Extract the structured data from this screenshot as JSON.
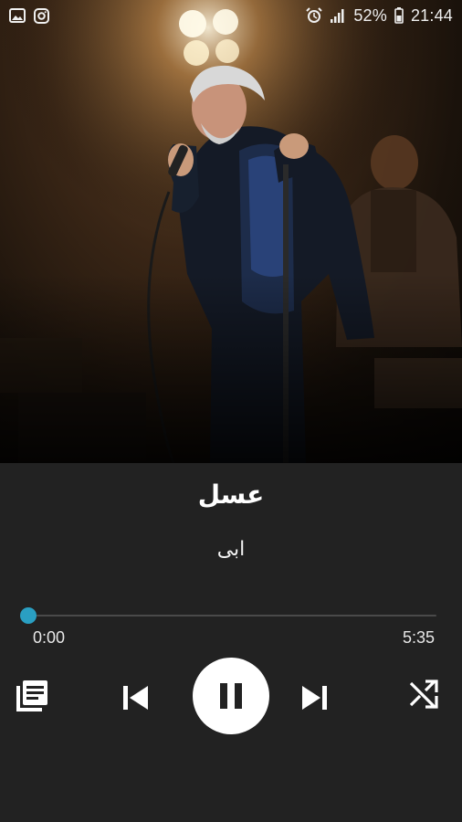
{
  "status_bar": {
    "battery": "52%",
    "time": "21:44",
    "left_icons": [
      "gallery-icon",
      "instagram-icon"
    ],
    "right_icons": [
      "alarm-icon",
      "signal-icon",
      "battery-icon"
    ]
  },
  "artwork": {
    "description_icon": "album-art"
  },
  "track": {
    "title": "عسل",
    "artist": "ابی"
  },
  "progress": {
    "elapsed": "0:00",
    "total": "5:35",
    "fraction": 0.0
  },
  "controls": {
    "icons": [
      "queue-icon",
      "previous-icon",
      "pause-icon",
      "next-icon",
      "shuffle-icon"
    ]
  },
  "colors": {
    "background": "#222222",
    "accent": "#2a9fc2",
    "play_button": "#ffffff"
  }
}
